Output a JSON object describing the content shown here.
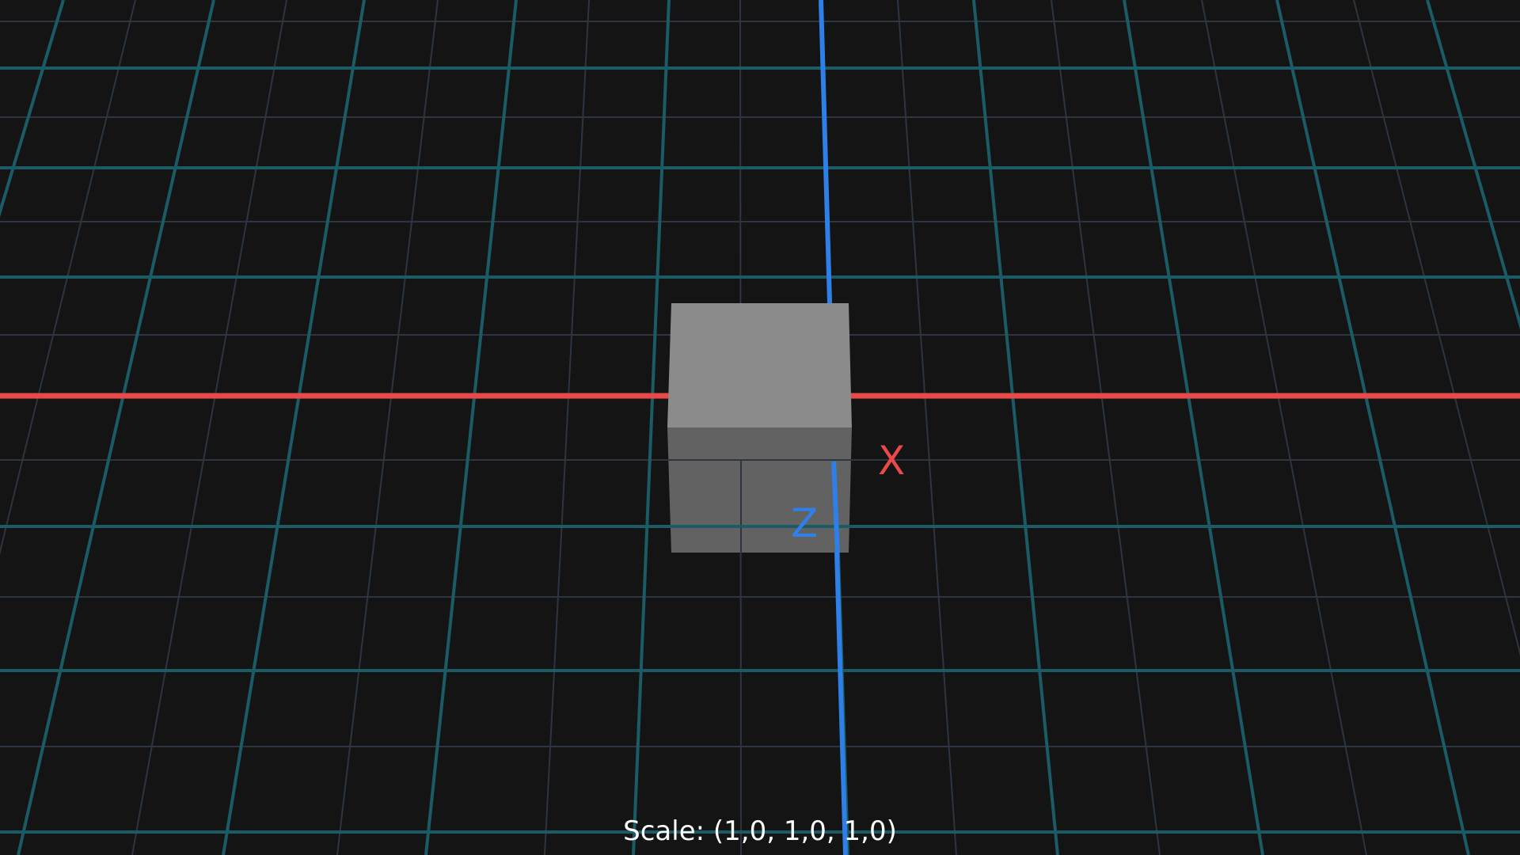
{
  "viewport": {
    "axes": {
      "x": {
        "label": "X",
        "color": "#e84a4a"
      },
      "z": {
        "label": "Z",
        "color": "#2e7fe8"
      }
    },
    "grid": {
      "major_color": "#1a5b66",
      "minor_color": "#2c3540"
    },
    "cube": {
      "top_color": "#8b8b8b",
      "front_color": "#626262"
    },
    "background": "#141414"
  },
  "status": {
    "scale_text": "Scale: (1,0, 1,0, 1,0)"
  }
}
